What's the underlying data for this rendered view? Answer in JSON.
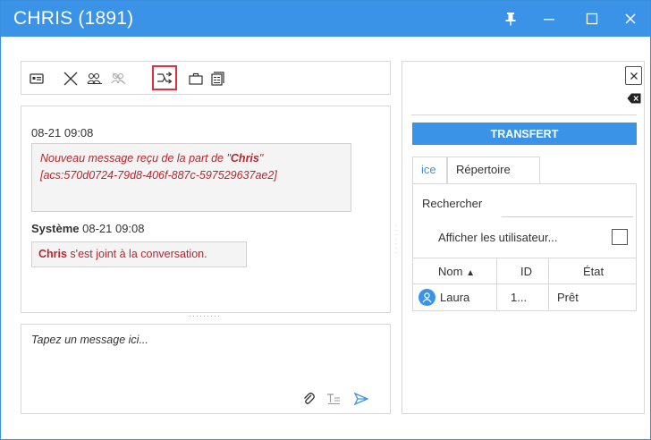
{
  "window": {
    "title": "CHRIS (1891)",
    "accent_color": "#3a93e6",
    "highlight_color": "#e0303a",
    "message_text_color": "#b8262e",
    "controls": {
      "pin_icon": "pin-icon",
      "minimize_icon": "minimize-icon",
      "maximize_icon": "maximize-icon",
      "close_icon": "close-icon"
    }
  },
  "toolbar": {
    "icons": [
      "contact-card-icon",
      "end-interaction-icon",
      "conference-icon",
      "disabled-conference-icon",
      "transfer-icon",
      "briefcase-icon",
      "script-icon"
    ],
    "highlighted": "transfer-icon"
  },
  "chat": {
    "messages": [
      {
        "time": "08-21 09:08",
        "text_prefix": "Nouveau message reçu de la part de \"",
        "sender": "Chris",
        "text_suffix": "\"",
        "detail": "[acs:570d0724-79d8-406f-887c-597529637ae2]"
      }
    ],
    "system": {
      "label": "Système",
      "time": "08-21 09:08",
      "user": "Chris",
      "text": " s'est joint à la conversation."
    }
  },
  "compose": {
    "placeholder": "Tapez un message ici...",
    "icons": [
      "attach-icon",
      "text-format-icon",
      "send-icon"
    ]
  },
  "right_panel": {
    "transfer_label": "TRANSFERT",
    "tabs": [
      "ice",
      "Répertoire"
    ],
    "active_tab": "ice",
    "search_label": "Rechercher",
    "show_users_label": "Afficher les utilisateur...",
    "show_users_checked": false,
    "columns": [
      "Nom",
      "ID",
      "État"
    ],
    "sort_indicator": "▲",
    "rows": [
      {
        "name": "Laura",
        "id": "1...",
        "status": "Prêt"
      }
    ]
  }
}
